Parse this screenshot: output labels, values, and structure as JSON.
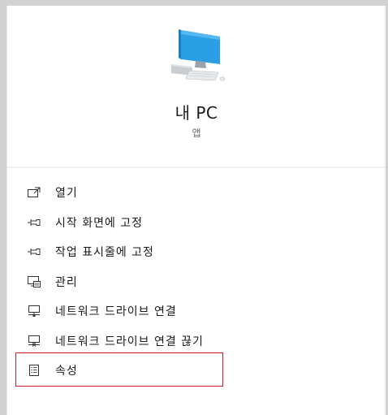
{
  "app": {
    "title": "내 PC",
    "subtitle": "앱",
    "icon": "computer-icon"
  },
  "menu": {
    "items": [
      {
        "label": "열기",
        "icon": "open-icon"
      },
      {
        "label": "시작 화면에 고정",
        "icon": "pin-icon"
      },
      {
        "label": "작업 표시줄에 고정",
        "icon": "pin-icon"
      },
      {
        "label": "관리",
        "icon": "manage-icon"
      },
      {
        "label": "네트워크 드라이브 연결",
        "icon": "network-drive-icon"
      },
      {
        "label": "네트워크 드라이브 연결 끊기",
        "icon": "disconnect-drive-icon"
      },
      {
        "label": "속성",
        "icon": "properties-icon"
      }
    ]
  },
  "colors": {
    "highlight_border": "#d41a23",
    "monitor_screen": "#2b9fe6"
  }
}
